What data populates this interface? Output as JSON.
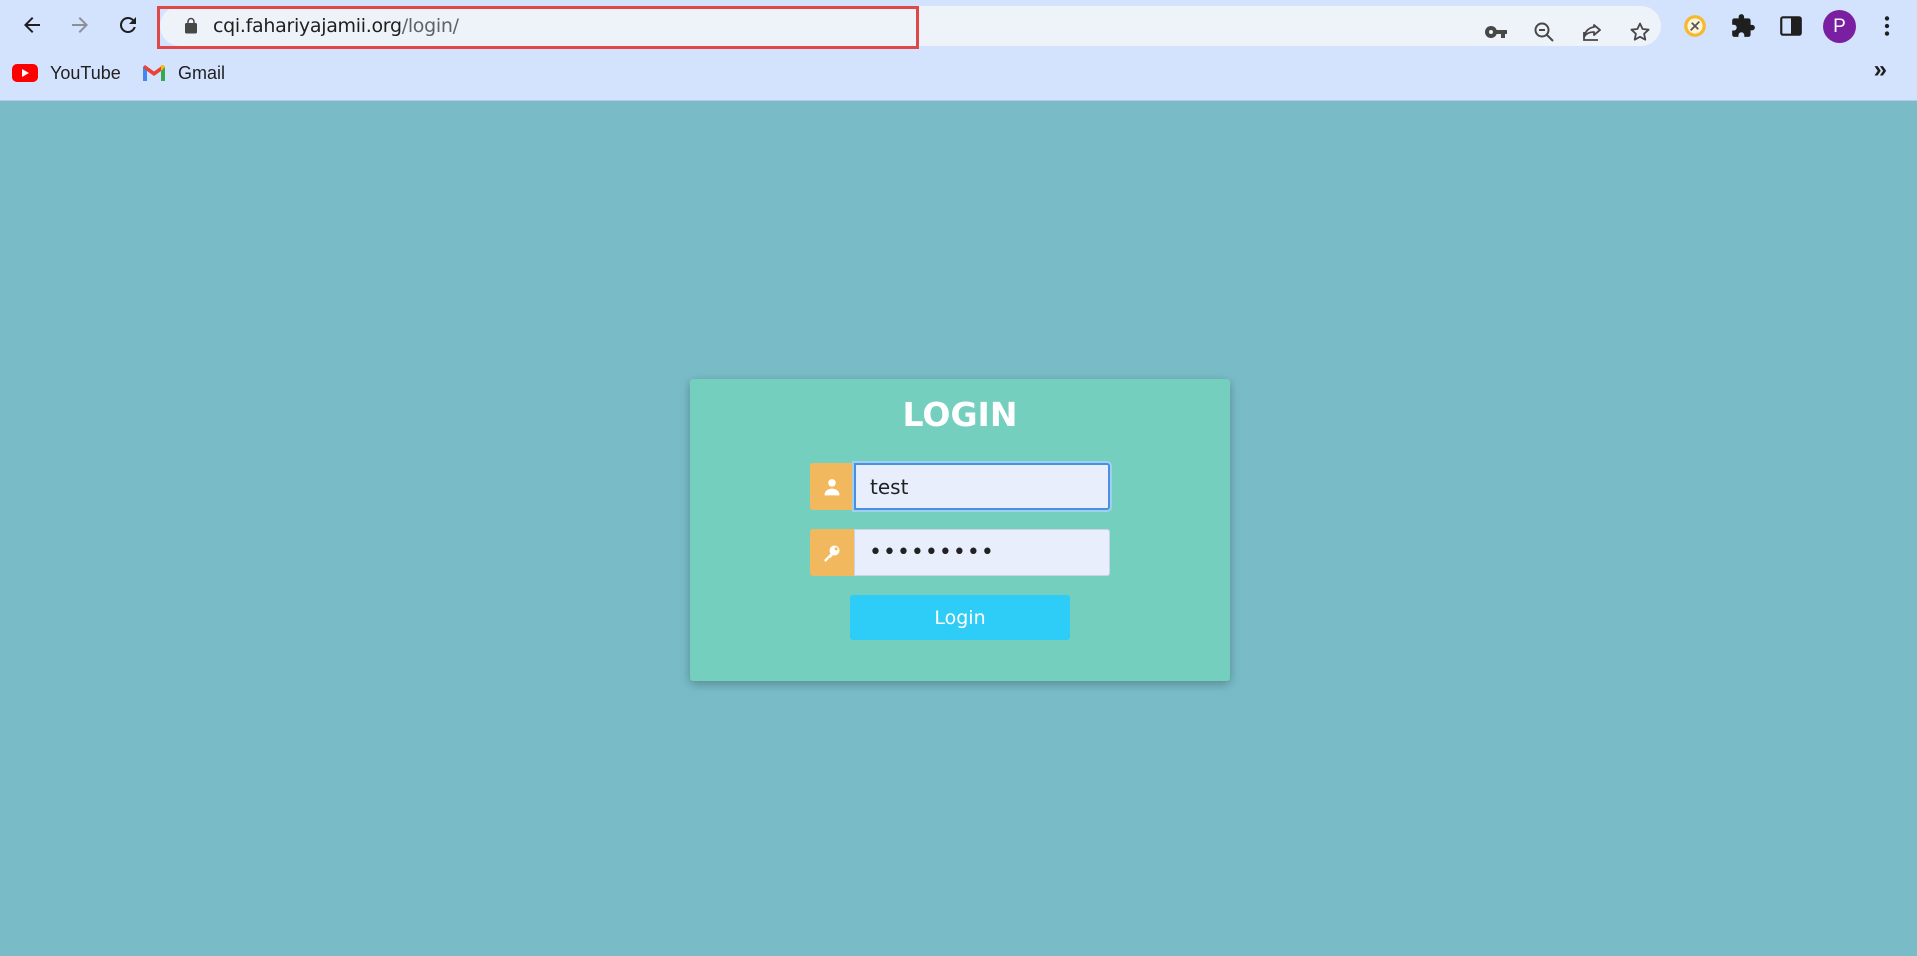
{
  "browser": {
    "url_host": "cqi.fahariyajamii.org",
    "url_path": "/login/",
    "profile_initial": "P",
    "bookmarks": [
      {
        "label": "YouTube",
        "icon": "youtube-icon"
      },
      {
        "label": "Gmail",
        "icon": "gmail-icon"
      }
    ],
    "bookmarks_overflow": "»"
  },
  "login": {
    "title": "LOGIN",
    "username_value": "test",
    "password_value": "•••••••••",
    "button_label": "Login"
  },
  "colors": {
    "page_bg": "#79bcc8",
    "card_bg": "#75cfbe",
    "icon_bg": "#f2b85e",
    "button_bg": "#2ecdf7",
    "highlight": "#e04848"
  }
}
